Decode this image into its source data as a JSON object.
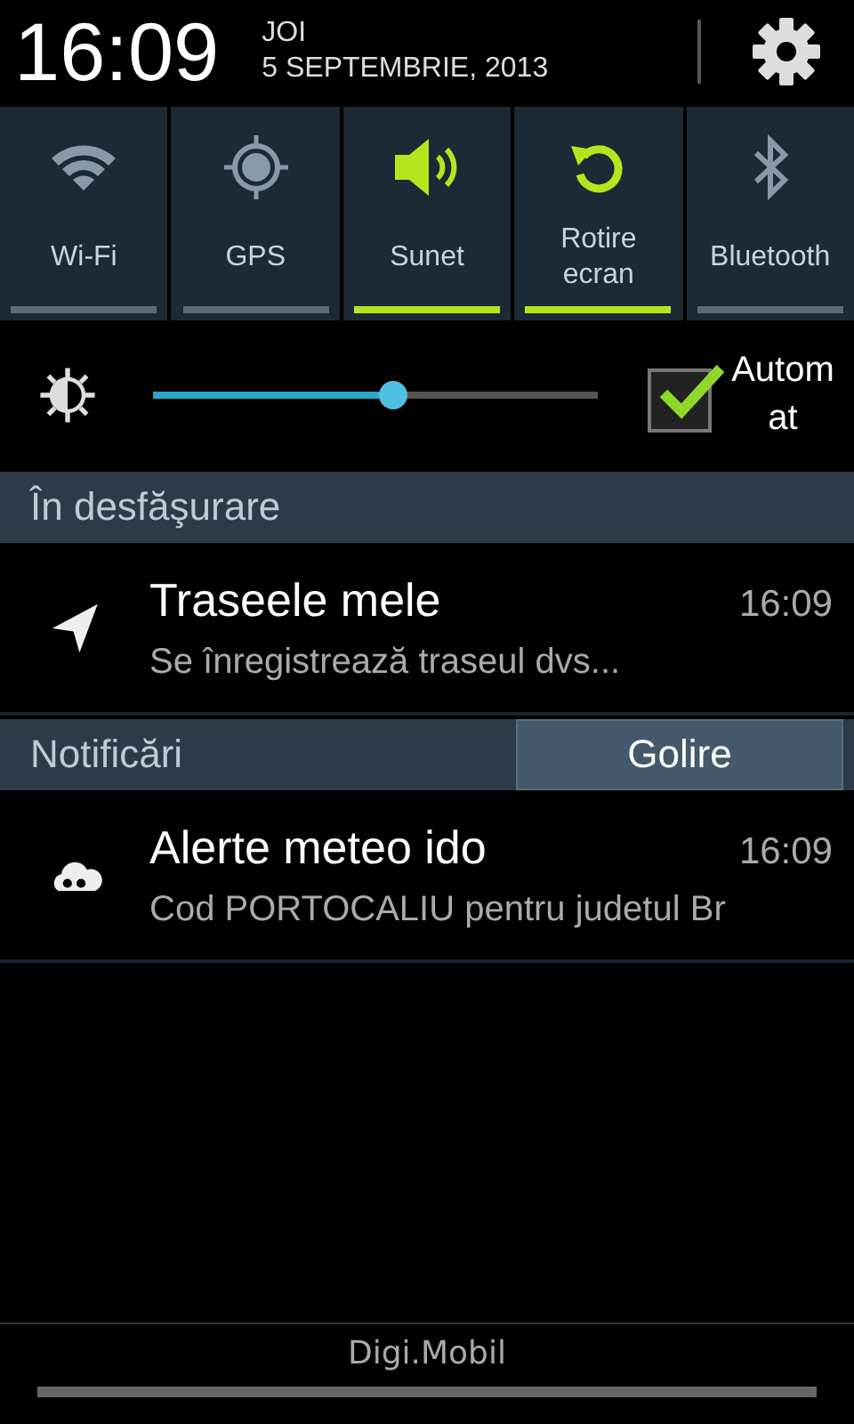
{
  "header": {
    "time": "16:09",
    "day": "JOI",
    "date": "5 SEPTEMBRIE, 2013"
  },
  "toggles": [
    {
      "kind": "wifi",
      "label": "Wi-Fi",
      "on": false
    },
    {
      "kind": "gps",
      "label": "GPS",
      "on": false
    },
    {
      "kind": "sound",
      "label": "Sunet",
      "on": true
    },
    {
      "kind": "rotate",
      "label": "Rotire ecran",
      "on": true
    },
    {
      "kind": "bluetooth",
      "label": "Bluetooth",
      "on": false
    }
  ],
  "brightness": {
    "level": 0.54,
    "auto_checked": true,
    "auto_label": "Autom at"
  },
  "ongoing": {
    "title": "În desfăşurare",
    "items": [
      {
        "kind": "navigation",
        "title": "Traseele mele",
        "time": "16:09",
        "text": "Se înregistrează traseul dvs..."
      }
    ]
  },
  "notifications": {
    "title": "Notificări",
    "clear_button": "Golire",
    "items": [
      {
        "kind": "weather",
        "title": "Alerte meteo ido",
        "time": "16:09",
        "text": "Cod  PORTOCALIU pentru judetul Br"
      }
    ]
  },
  "carrier": "Digi.Mobil"
}
